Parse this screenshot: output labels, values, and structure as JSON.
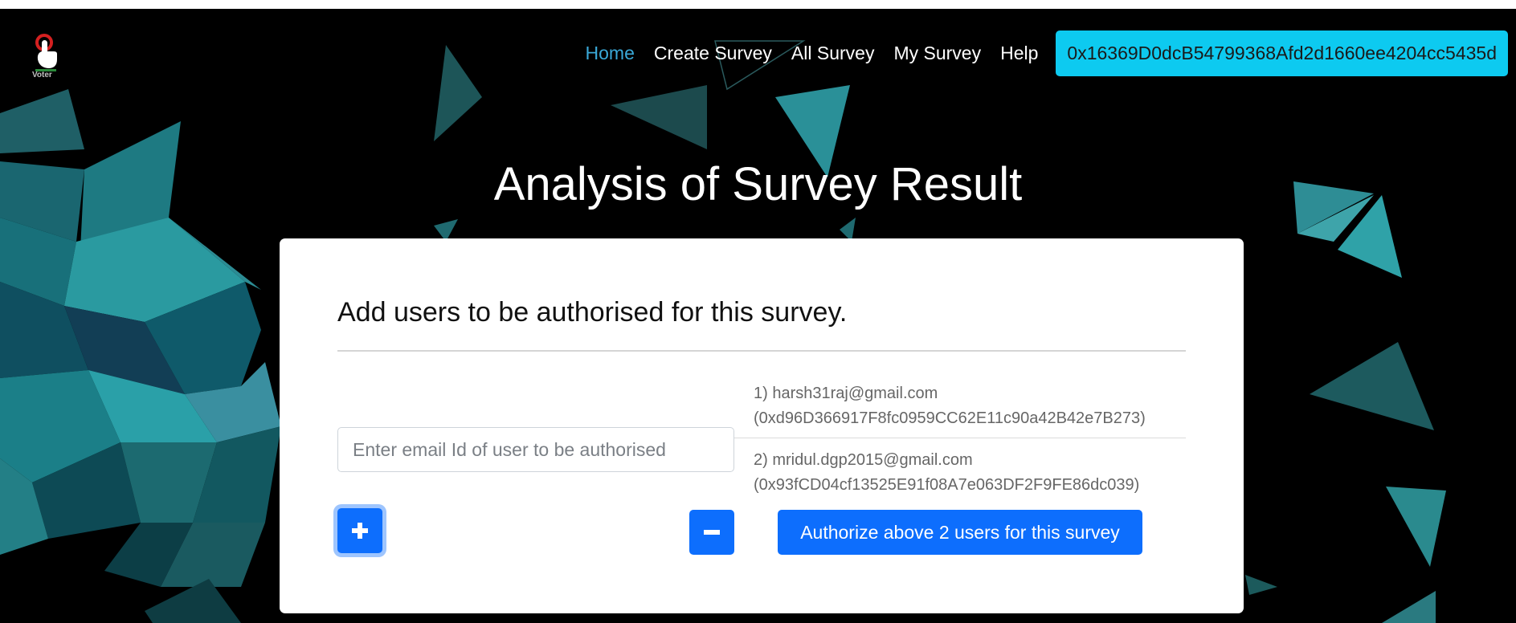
{
  "app": {
    "logo_text": "Voter",
    "colors": {
      "accent": "#0d6efd",
      "wallet": "#0dcaf0",
      "nav_active": "#3aa9d8"
    }
  },
  "nav": {
    "items": [
      {
        "label": "Home",
        "active": true
      },
      {
        "label": "Create Survey",
        "active": false
      },
      {
        "label": "All Survey",
        "active": false
      },
      {
        "label": "My Survey",
        "active": false
      },
      {
        "label": "Help",
        "active": false
      }
    ],
    "wallet_address": "0x16369D0dcB54799368Afd2d1660ee4204cc5435d"
  },
  "page": {
    "title": "Analysis of Survey Result"
  },
  "card": {
    "title": "Add users to be authorised for this survey.",
    "email_input": {
      "placeholder": "Enter email Id of user to be authorised",
      "value": ""
    },
    "users": [
      {
        "line1": "1) harsh31raj@gmail.com",
        "line2": "(0xd96D366917F8fc0959CC62E11c90a42B42e7B273)"
      },
      {
        "line1": "2) mridul.dgp2015@gmail.com",
        "line2": "(0x93fCD04cf13525E91f08A7e063DF2F9FE86dc039)"
      }
    ],
    "buttons": {
      "plus_icon": "plus-icon",
      "minus_icon": "minus-icon",
      "authorize_label": "Authorize above 2 users for this survey"
    }
  }
}
